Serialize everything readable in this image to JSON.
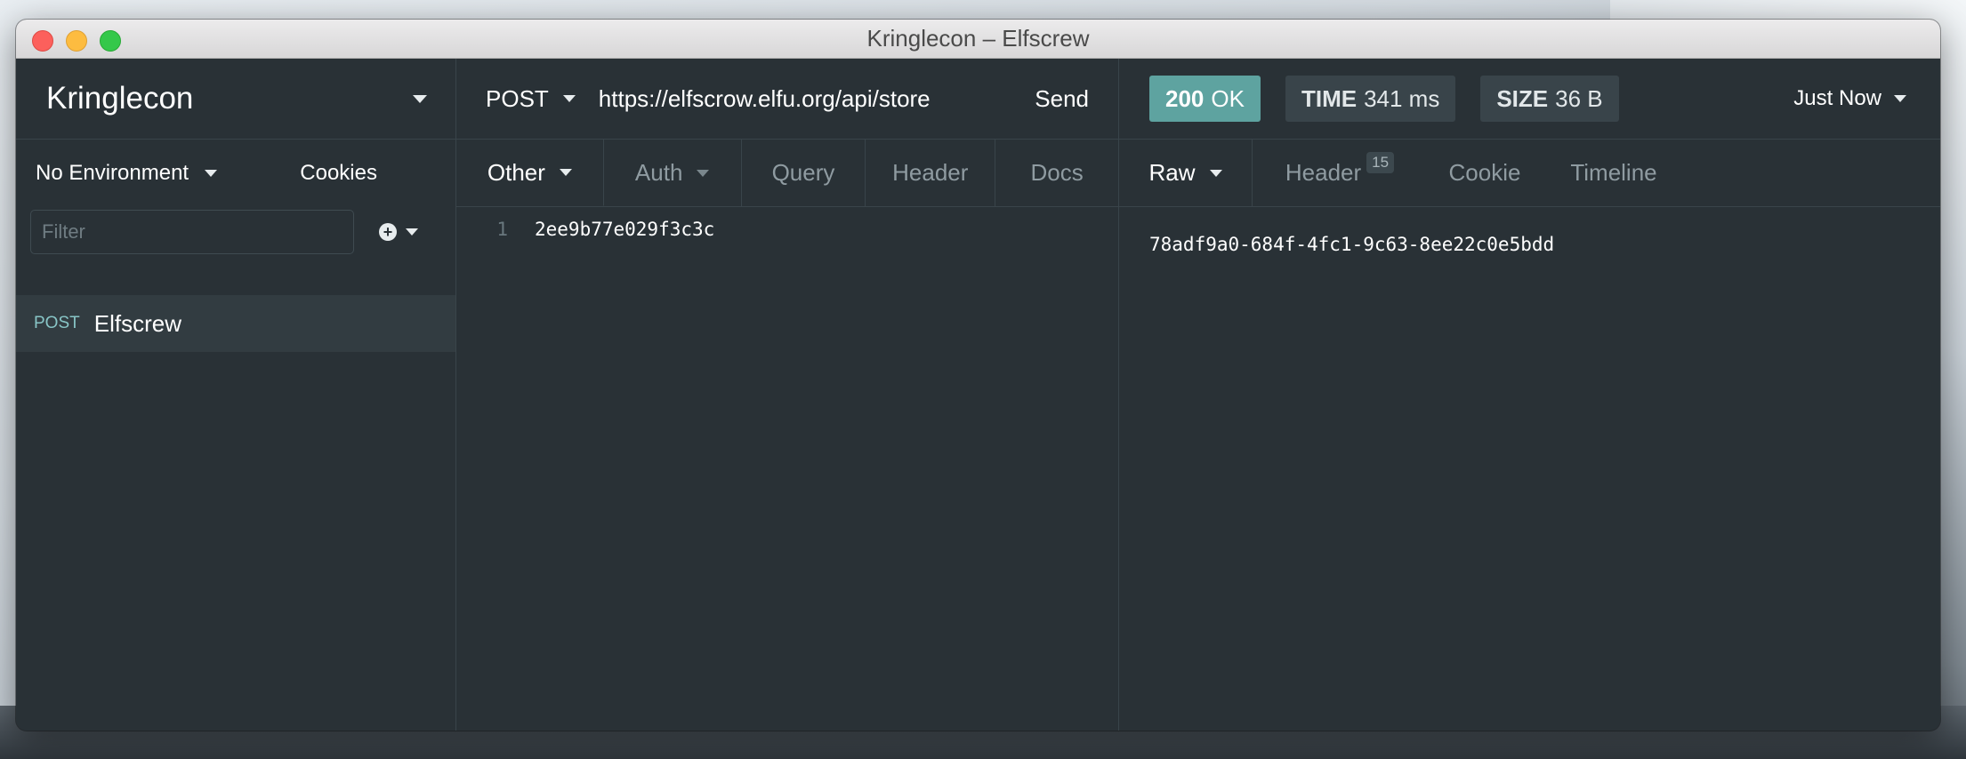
{
  "window": {
    "title": "Kringlecon – Elfscrew"
  },
  "sidebar": {
    "workspace_name": "Kringlecon",
    "environment_label": "No Environment",
    "cookies_label": "Cookies",
    "filter_placeholder": "Filter",
    "requests": [
      {
        "method": "POST",
        "name": "Elfscrew",
        "selected": true
      }
    ]
  },
  "request": {
    "method": "POST",
    "url": "https://elfscrow.elfu.org/api/store",
    "send_label": "Send",
    "tabs": [
      {
        "label": "Other",
        "active": true,
        "has_dropdown": true
      },
      {
        "label": "Auth",
        "active": false,
        "has_dropdown": true
      },
      {
        "label": "Query",
        "active": false
      },
      {
        "label": "Header",
        "active": false
      },
      {
        "label": "Docs",
        "active": false
      }
    ],
    "body_lines": [
      {
        "number": "1",
        "text": "2ee9b77e029f3c3c"
      }
    ]
  },
  "response": {
    "status_code": "200",
    "status_text": "OK",
    "time_label": "TIME",
    "time_value": "341 ms",
    "size_label": "SIZE",
    "size_value": "36 B",
    "history_label": "Just Now",
    "tabs": [
      {
        "label": "Raw",
        "active": true,
        "has_dropdown": true
      },
      {
        "label": "Header",
        "active": false,
        "count": "15"
      },
      {
        "label": "Cookie",
        "active": false
      },
      {
        "label": "Timeline",
        "active": false
      }
    ],
    "body": "78adf9a0-684f-4fc1-9c63-8ee22c0e5bdd"
  },
  "colors": {
    "background": "#293136",
    "status_ok": "#5ea3a0",
    "method_post": "#88c5c6"
  }
}
